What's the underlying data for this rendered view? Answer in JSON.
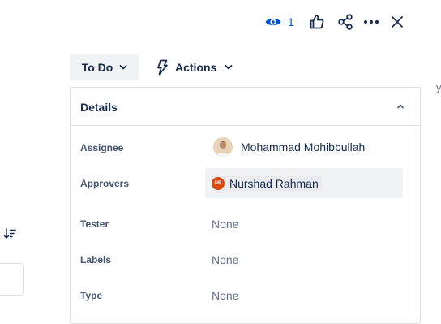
{
  "toolbar": {
    "watch_count": "1"
  },
  "status": {
    "label": "To Do"
  },
  "actions": {
    "label": "Actions"
  },
  "details": {
    "title": "Details",
    "fields": {
      "assignee": {
        "label": "Assignee",
        "value": "Mohammad Mohibbullah"
      },
      "approvers": {
        "label": "Approvers",
        "value": "Nurshad Rahman",
        "initials": "NR"
      },
      "tester": {
        "label": "Tester",
        "value": "None"
      },
      "labels": {
        "label": "Labels",
        "value": "None"
      },
      "type": {
        "label": "Type",
        "value": "None"
      }
    }
  },
  "colors": {
    "accent": "#0052cc",
    "status_bg": "#f1f2f4",
    "approver_avatar": "#d9480f"
  },
  "icons": [
    "eye-icon",
    "thumbs-up-icon",
    "share-icon",
    "more-icon",
    "close-icon",
    "chevron-down-icon",
    "lightning-icon",
    "chevron-up-icon",
    "sort-icon"
  ]
}
